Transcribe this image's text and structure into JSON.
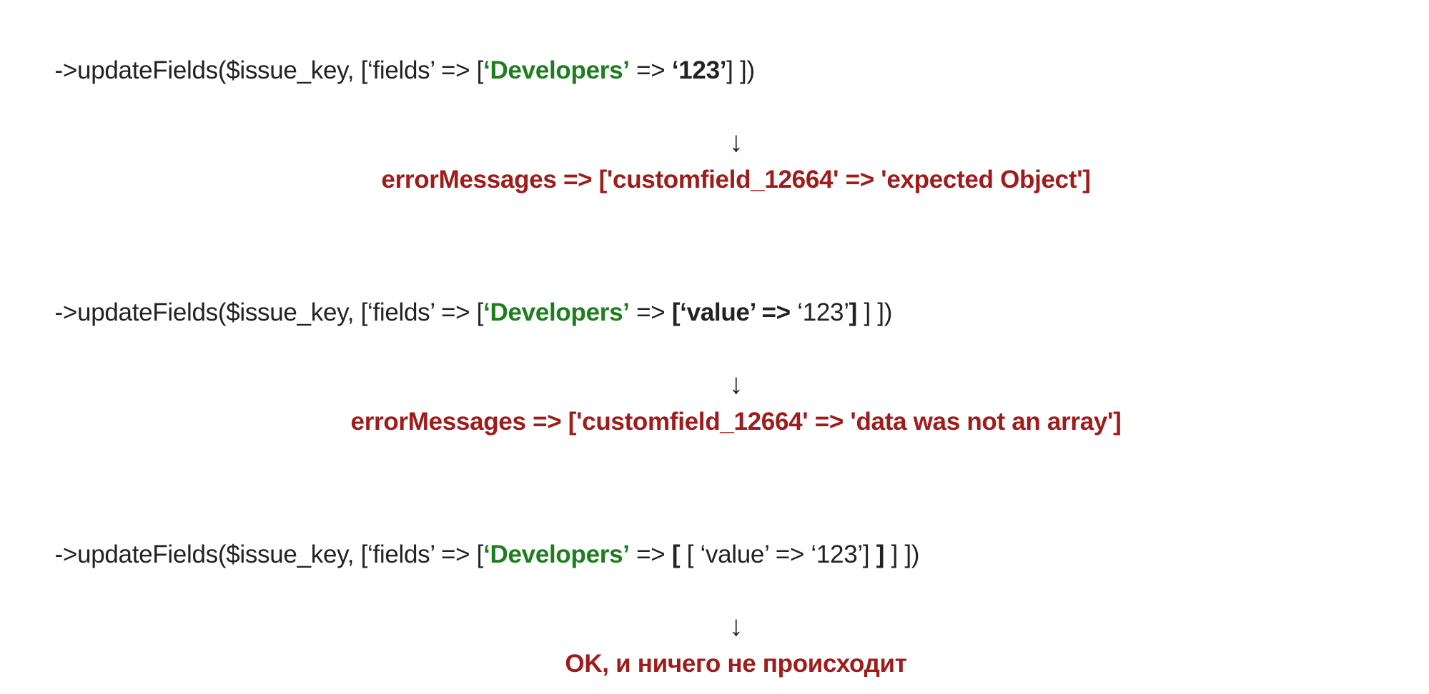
{
  "blocks": [
    {
      "code": {
        "p1": "->updateFields($issue_key, [‘fields’ => [",
        "dev": "‘Developers’",
        "p2": " => ",
        "val_bold": "‘123’",
        "val_reg": "",
        "p3": "] ])"
      },
      "arrow": "↓",
      "result": "errorMessages => ['customfield_12664' => 'expected Object']"
    },
    {
      "code": {
        "p1": "->updateFields($issue_key, [‘fields’ => [",
        "dev": "‘Developers’",
        "p2": " => ",
        "val_bold_open": "[‘value’ => ",
        "val_reg": "‘123’",
        "val_bold_close": "]",
        "p3": " ] ])"
      },
      "arrow": "↓",
      "result": "errorMessages => ['customfield_12664' => 'data was not an array']"
    },
    {
      "code": {
        "p1": "->updateFields($issue_key, [‘fields’ => [",
        "dev": "‘Developers’",
        "p2": " => ",
        "val_bold_open": "[ ",
        "val_reg": "[ ‘value’ => ‘123’]",
        "val_bold_close": " ]",
        "p3": " ] ])"
      },
      "arrow": "↓",
      "result": "OK, и ничего не происходит"
    }
  ]
}
